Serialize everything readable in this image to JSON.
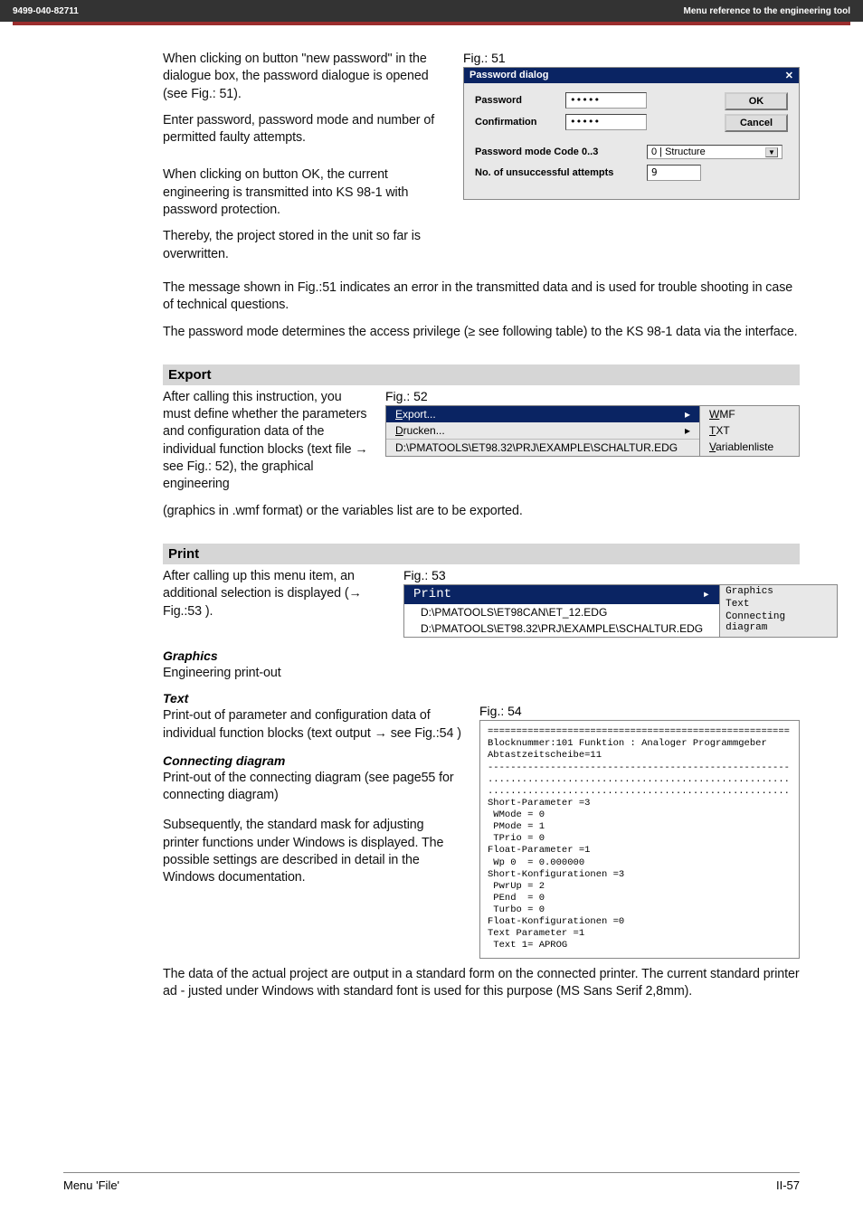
{
  "header": {
    "left": "9499-040-82711",
    "right": "Menu reference to the engineering tool"
  },
  "intro": {
    "p1": "When clicking on button \"new password\" in the dialogue box, the password dialogue is opened (see Fig.: 51).",
    "p2": "Enter password, password mode and number of permitted faulty attempts.",
    "p3": "When clicking on button OK, the current engineering is transmitted into KS 98-1 with password protection.",
    "p4": "Thereby, the project stored in the unit so far is overwritten.",
    "p5": "The message shown in Fig.:51 indicates an error in the transmitted data and is used for trouble shooting in case of technical questions.",
    "p6": "The password mode determines the access privilege (≥ see following table) to the KS 98-1 data via the interface."
  },
  "fig51": {
    "label": "Fig.: 51",
    "title": "Password dialog",
    "close_x": "✕",
    "password_lbl": "Password",
    "password_val": "•••••",
    "confirm_lbl": "Confirmation",
    "confirm_val": "•••••",
    "ok": "OK",
    "cancel": "Cancel",
    "mode_lbl": "Password mode Code 0..3",
    "mode_val": "0 | Structure",
    "attempts_lbl": "No. of unsuccessful attempts",
    "attempts_val": "9"
  },
  "export": {
    "heading": "Export",
    "left_text": "After calling this instruction, you must define whether the parameters and configuration data of the individual function blocks (text file → see Fig.: 52), the graphical engineering",
    "after": "(graphics in .wmf format) or the variables list are to be exported.",
    "fig_label": "Fig.: 52",
    "menu_export": "Export...",
    "menu_drucken": "Drucken...",
    "path": "D:\\PMATOOLS\\ET98.32\\PRJ\\EXAMPLE\\SCHALTUR.EDG",
    "sub_wmf": "WMF",
    "sub_txt": "TXT",
    "sub_var": "Variablenliste"
  },
  "print": {
    "heading": "Print",
    "left_text": "After calling up this menu item, an additional selection is displayed (→ Fig.:53 ).",
    "fig_label": "Fig.: 53",
    "menu_print": "Print",
    "path1": "D:\\PMATOOLS\\ET98CAN\\ET_12.EDG",
    "path2": "D:\\PMATOOLS\\ET98.32\\PRJ\\EXAMPLE\\SCHALTUR.EDG",
    "sub_graphics": "Graphics",
    "sub_text": "Text",
    "sub_conn": "Connecting diagram"
  },
  "graphics": {
    "heading": "Graphics",
    "text": "Engineering print-out"
  },
  "text_sec": {
    "heading": "Text",
    "text": "Print-out of parameter and configuration data of individual function blocks (text output → see Fig.:54 )"
  },
  "conn": {
    "heading": "Connecting diagram",
    "text": "Print-out of the connecting diagram (see page55 for connecting diagram)",
    "after": "Subsequently, the standard mask for adjusting printer functions under Windows is displayed. The possible settings are described in detail in the Windows documentation."
  },
  "fig54": {
    "label": "Fig.: 54",
    "body": "=====================================================\nBlocknummer:101 Funktion : Analoger Programmgeber\nAbtastzeitscheibe=11\n-----------------------------------------------------\n.....................................................\n.....................................................\nShort-Parameter =3\n WMode = 0\n PMode = 1\n TPrio = 0\nFloat-Parameter =1\n Wp 0  = 0.000000\nShort-Konfigurationen =3\n PwrUp = 2\n PEnd  = 0\n Turbo = 0\nFloat-Konfigurationen =0\nText Parameter =1\n Text 1= APROG"
  },
  "closing": "The data of the actual project are output in a standard form on the connected printer. The current standard printer ad - justed under Windows with standard font is used for this purpose (MS Sans Serif 2,8mm).",
  "footer": {
    "left": "Menu 'File'",
    "right": "II-57"
  }
}
